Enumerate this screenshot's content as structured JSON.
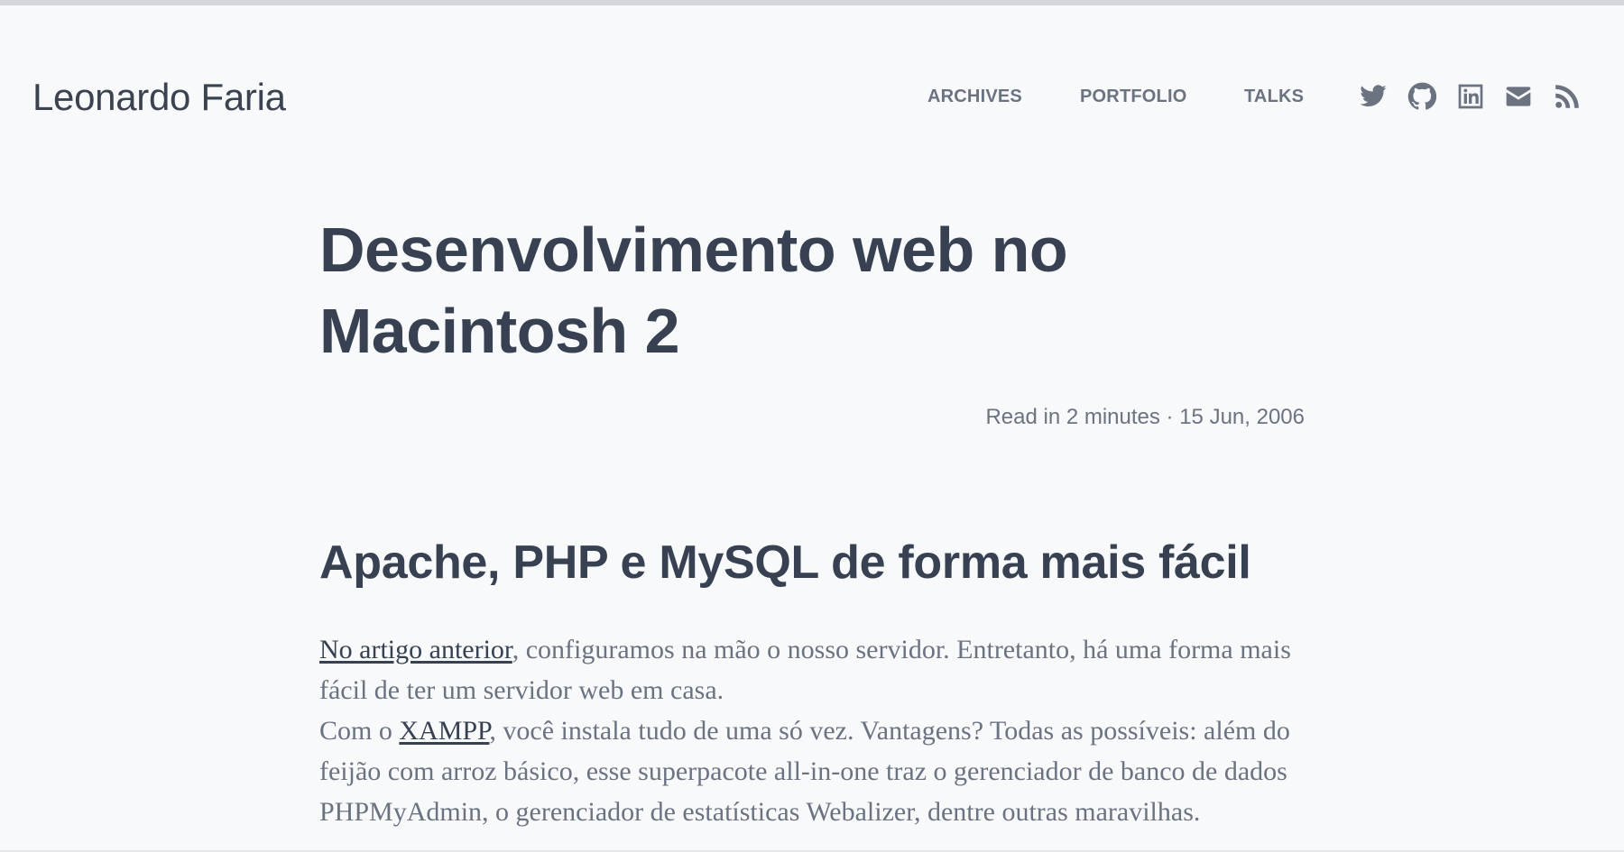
{
  "site": {
    "title": "Leonardo Faria"
  },
  "nav": {
    "items": [
      {
        "label": "ARCHIVES"
      },
      {
        "label": "PORTFOLIO"
      },
      {
        "label": "TALKS"
      }
    ],
    "social": [
      {
        "icon": "twitter-icon"
      },
      {
        "icon": "github-icon"
      },
      {
        "icon": "linkedin-icon"
      },
      {
        "icon": "mail-icon"
      },
      {
        "icon": "rss-icon"
      }
    ]
  },
  "post": {
    "title": "Desenvolvimento web no Macintosh 2",
    "meta": "Read in 2 minutes · 15 Jun, 2006",
    "heading": "Apache, PHP e MySQL de forma mais fácil",
    "p1_link": "No artigo anterior",
    "p1_rest": ", configuramos na mão o nosso servidor. Entretanto, há uma forma mais fácil de ter um servidor web em casa.",
    "p2_start": "Com o ",
    "p2_link": "XAMPP",
    "p2_rest": ", você instala tudo de uma só vez. Vantagens? Todas as possíveis: além do feijão com arroz básico, esse superpacote all-in-one traz o gerenciador de banco de dados PHPMyAdmin, o gerenciador de estatísticas Webalizer, dentre outras maravilhas."
  },
  "colors": {
    "background": "#f8f9fb",
    "text": "#374151",
    "muted": "#6b7280",
    "top_bar": "#d4d6dc"
  }
}
